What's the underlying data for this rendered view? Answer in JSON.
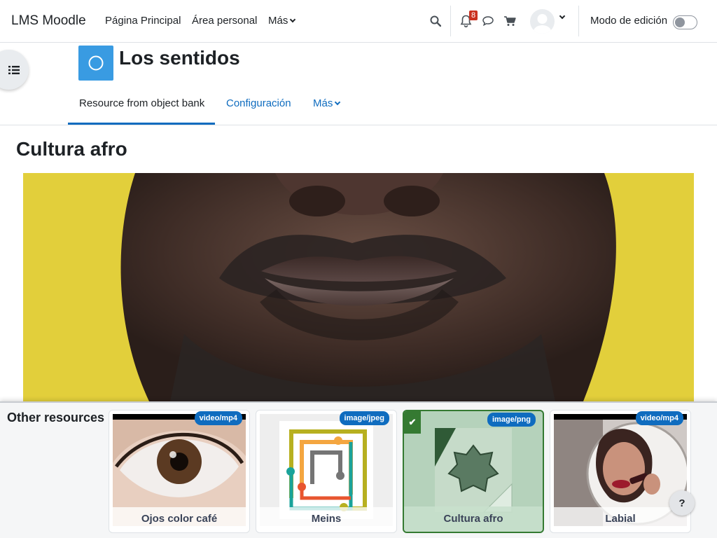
{
  "navbar": {
    "brand": "LMS Moodle",
    "links": [
      "Página Principal",
      "Área personal"
    ],
    "more_label": "Más",
    "notification_count": "8",
    "edit_mode_label": "Modo de edición",
    "edit_mode_on": false,
    "icons": [
      "search-icon",
      "bell-icon",
      "chat-icon",
      "cart-icon",
      "avatar",
      "chevron-down-icon"
    ]
  },
  "course": {
    "title": "Los sentidos",
    "tabs": [
      {
        "label": "Resource from object bank",
        "active": true
      },
      {
        "label": "Configuración",
        "active": false
      },
      {
        "label": "Más",
        "active": false
      }
    ]
  },
  "page": {
    "heading": "Cultura afro"
  },
  "resources": {
    "title": "Other resources",
    "items": [
      {
        "label": "Ojos color café",
        "type": "video/mp4",
        "selected": false
      },
      {
        "label": "Meins",
        "type": "image/jpeg",
        "selected": false
      },
      {
        "label": "Cultura afro",
        "type": "image/png",
        "selected": true
      },
      {
        "label": "Labial",
        "type": "video/mp4",
        "selected": false
      }
    ],
    "check_mark": "✔"
  },
  "help": {
    "label": "?"
  },
  "colors": {
    "primary": "#0f6cbf",
    "course_icon": "#399be2",
    "badge_red": "#ca3120",
    "selected_green": "#357a32",
    "hero_background": "#e2cf3b"
  }
}
